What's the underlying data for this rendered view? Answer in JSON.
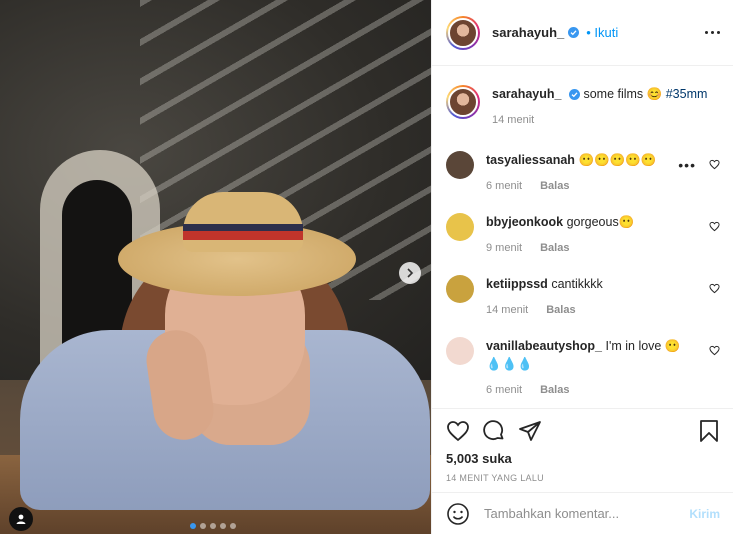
{
  "post": {
    "author": "sarahayuh_",
    "follow_label": "• Ikuti",
    "photo_alt": "",
    "carousel": {
      "count": 5,
      "active_index": 0
    }
  },
  "caption": {
    "username": "sarahayuh_",
    "text": "some films 😊",
    "hashtag": "#35mm",
    "time": "14 menit"
  },
  "comments": [
    {
      "username": "tasyaliessanah",
      "text": "😶😶😶😶😶",
      "time": "6 menit",
      "reply": "Balas",
      "avatar_color": "#5a4638",
      "more": "•••"
    },
    {
      "username": "bbyjeonkook",
      "text": "gorgeous😶",
      "time": "9 menit",
      "reply": "Balas",
      "avatar_color": "#e8c34a"
    },
    {
      "username": "ketiippssd",
      "text": "cantikkkk",
      "time": "14 menit",
      "reply": "Balas",
      "avatar_color": "#c9a23e"
    },
    {
      "username": "vanillabeautyshop_",
      "text": "I'm in love 😶 💧💧💧",
      "time": "6 menit",
      "reply": "Balas",
      "avatar_color": "#f2d9d0"
    }
  ],
  "actions": {
    "likes": "5,003 suka",
    "time_ago": "14 MENIT YANG LALU"
  },
  "add_comment": {
    "placeholder": "Tambahkan komentar...",
    "post_label": "Kirim"
  },
  "icons": {
    "like": "heart-icon",
    "comment": "comment-icon",
    "share": "share-icon",
    "save": "bookmark-icon",
    "emoji": "emoji-icon",
    "more": "more-options-icon",
    "next": "chevron-right-icon",
    "verified": "verified-badge-icon",
    "tags": "user-tag-icon"
  },
  "colors": {
    "link": "#0095f6",
    "verified": "#3897f0",
    "muted": "#8e8e8e",
    "post_disabled": "#b2dffc"
  }
}
